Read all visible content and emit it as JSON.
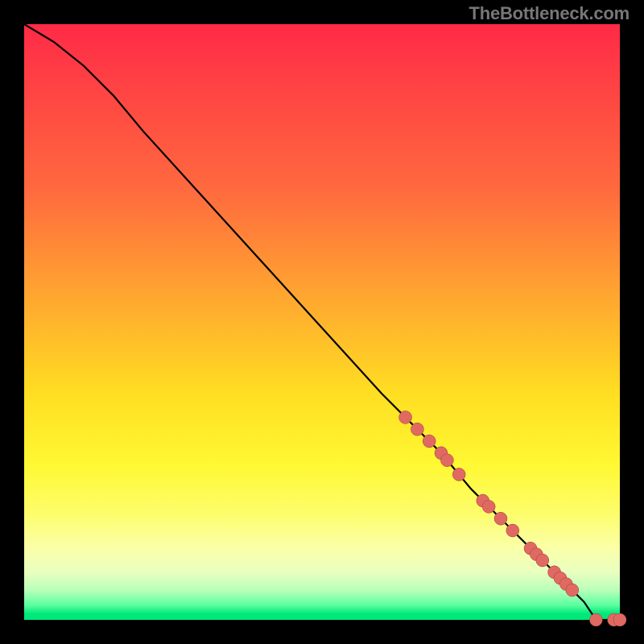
{
  "watermark": "TheBottleneck.com",
  "chart_data": {
    "type": "line",
    "title": "",
    "xlabel": "",
    "ylabel": "",
    "xlim": [
      0,
      1
    ],
    "ylim": [
      0,
      1
    ],
    "series": [
      {
        "name": "curve",
        "x": [
          0.0,
          0.05,
          0.1,
          0.15,
          0.2,
          0.3,
          0.4,
          0.5,
          0.6,
          0.65,
          0.7,
          0.75,
          0.8,
          0.85,
          0.88,
          0.9,
          0.92,
          0.94,
          0.96,
          1.0
        ],
        "y": [
          1.0,
          0.97,
          0.93,
          0.88,
          0.82,
          0.71,
          0.6,
          0.49,
          0.38,
          0.33,
          0.28,
          0.22,
          0.17,
          0.12,
          0.09,
          0.07,
          0.05,
          0.03,
          0.0,
          0.0
        ]
      }
    ],
    "points_on_curve_x": [
      0.64,
      0.66,
      0.68,
      0.7,
      0.71,
      0.73,
      0.77,
      0.78,
      0.8,
      0.82,
      0.85,
      0.86,
      0.87,
      0.89,
      0.9,
      0.91,
      0.92,
      0.96,
      0.99,
      1.0
    ],
    "point_radius": 8
  }
}
